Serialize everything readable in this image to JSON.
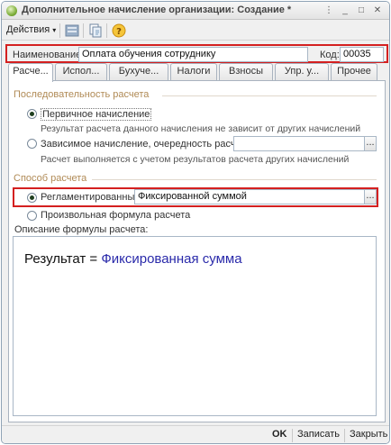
{
  "window": {
    "title": "Дополнительное начисление организации: Создание *"
  },
  "toolbar": {
    "actions_label": "Действия",
    "icons": [
      "tree-structure-icon",
      "copy-icon",
      "help-icon"
    ]
  },
  "header": {
    "name_label": "Наименование:",
    "name_value": "Оплата обучения сотруднику",
    "code_label": "Код:",
    "code_value": "00035"
  },
  "tabs": [
    {
      "label": "Расче...",
      "active": true
    },
    {
      "label": "Испол...",
      "active": false
    },
    {
      "label": "Бухуче...",
      "active": false
    },
    {
      "label": "Налоги",
      "active": false
    },
    {
      "label": "Взносы",
      "active": false
    },
    {
      "label": "Упр. у...",
      "active": false
    },
    {
      "label": "Прочее",
      "active": false
    }
  ],
  "sequence": {
    "title": "Последовательность расчета",
    "option1_label": "Первичное начисление",
    "option1_hint": "Результат расчета данного начисления не зависит от других начислений",
    "option2_label": "Зависимое начисление, очередность расчета:",
    "option2_value": "",
    "option2_hint": "Расчет выполняется с учетом результатов расчета других начислений"
  },
  "method": {
    "title": "Способ расчета",
    "option1_label": "Регламентированный:",
    "option1_value": "Фиксированной суммой",
    "option2_label": "Произвольная формула расчета"
  },
  "description": {
    "label": "Описание формулы расчета:",
    "result_word": "Результат",
    "operator": "=",
    "value": "Фиксированная сумма"
  },
  "bottom": {
    "ok_label": "OK",
    "save_label": "Записать",
    "close_label": "Закрыть"
  }
}
